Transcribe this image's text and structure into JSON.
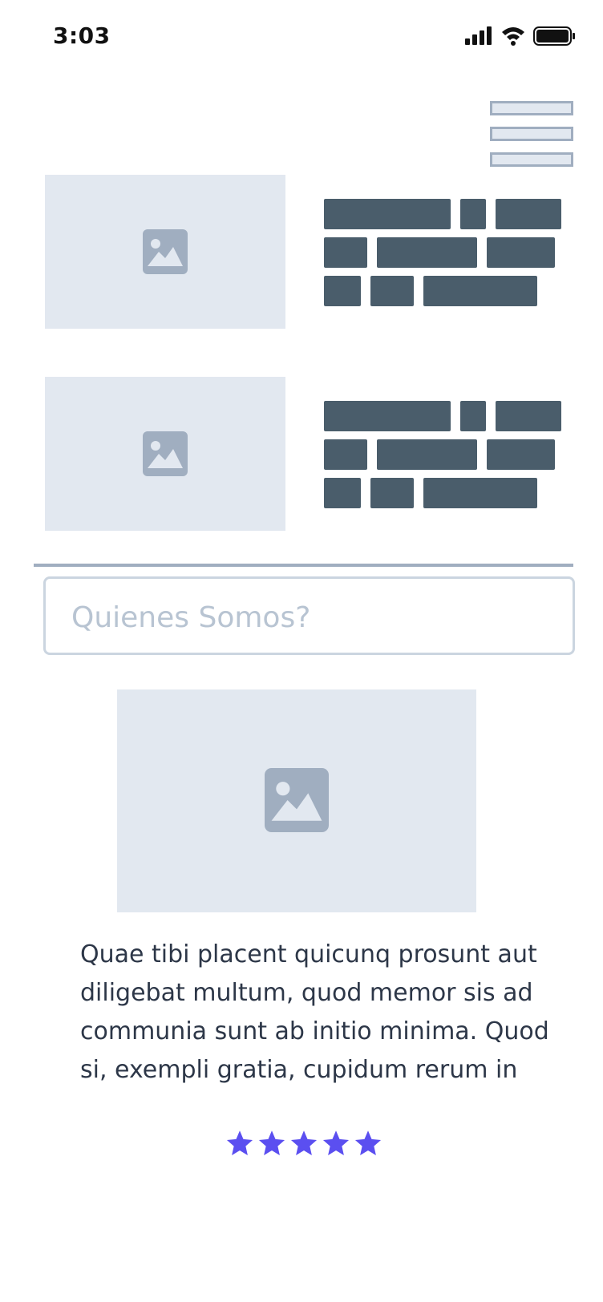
{
  "status_bar": {
    "time": "3:03",
    "icons": [
      "signal-icon",
      "wifi-icon",
      "battery-icon"
    ]
  },
  "menu": {
    "icon": "hamburger-menu-icon"
  },
  "gallery": {
    "items": [
      {
        "image_icon": "image-placeholder-icon"
      },
      {
        "image_icon": "image-placeholder-icon"
      }
    ]
  },
  "search": {
    "placeholder": "Quienes Somos?",
    "value": ""
  },
  "about": {
    "image_icon": "image-placeholder-icon",
    "text": "Quae tibi placent quicunq prosunt aut diligebat multum, quod memor sis ad communia sunt ab initio minima. Quod si, exempli gratia, cupidum rerum in"
  },
  "rating": {
    "stars": 5,
    "max": 5,
    "color": "#5b4ff0"
  },
  "colors": {
    "placeholder_bg": "#e2e8f0",
    "placeholder_icon": "#a0aec0",
    "text_block": "#4a5d6b",
    "body_text": "#2d3748",
    "accent": "#5b4ff0"
  }
}
